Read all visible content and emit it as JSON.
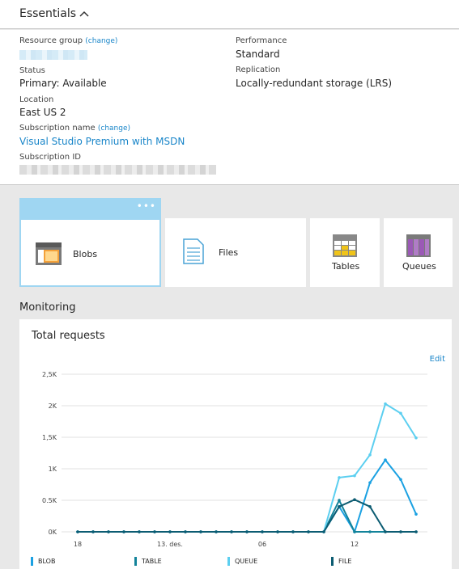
{
  "header": {
    "title": "Essentials"
  },
  "essentials": {
    "resource_group": {
      "label": "Resource group",
      "change": "(change)"
    },
    "status": {
      "label": "Status",
      "value": "Primary: Available"
    },
    "location": {
      "label": "Location",
      "value": "East US 2"
    },
    "subscription_name": {
      "label": "Subscription name",
      "change": "(change)",
      "value": "Visual Studio Premium with MSDN"
    },
    "subscription_id": {
      "label": "Subscription ID"
    },
    "performance": {
      "label": "Performance",
      "value": "Standard"
    },
    "replication": {
      "label": "Replication",
      "value": "Locally-redundant storage (LRS)"
    }
  },
  "services": {
    "blobs": "Blobs",
    "files": "Files",
    "tables": "Tables",
    "queues": "Queues",
    "more": "•••"
  },
  "monitoring": {
    "heading": "Monitoring",
    "edit": "Edit"
  },
  "colors": {
    "blob": "#1ba1e2",
    "table": "#13839a",
    "queue": "#5ccff0",
    "file": "#0c5c72",
    "accent": "#1a86c9"
  },
  "chart_data": {
    "type": "line",
    "title": "Total requests",
    "ylim": [
      0,
      2500
    ],
    "y_ticks": [
      "2,5K",
      "2K",
      "1,5K",
      "1K",
      "0.5K",
      "0K"
    ],
    "y_tick_values": [
      2500,
      2000,
      1500,
      1000,
      500,
      0
    ],
    "x_ticks": [
      "18",
      "13. des.",
      "06",
      "12"
    ],
    "x_tick_index": [
      0,
      6,
      12,
      18
    ],
    "grid": true,
    "legend": "bottom",
    "series": [
      {
        "name": "BLOB",
        "color": "#1ba1e2",
        "values": [
          0,
          0,
          0,
          0,
          0,
          0,
          0,
          0,
          0,
          0,
          0,
          0,
          0,
          0,
          0,
          0,
          0,
          400,
          0,
          780,
          1140,
          830,
          280
        ]
      },
      {
        "name": "TABLE",
        "color": "#13839a",
        "values": [
          0,
          0,
          0,
          0,
          0,
          0,
          0,
          0,
          0,
          0,
          0,
          0,
          0,
          0,
          0,
          0,
          0,
          500,
          0,
          0,
          0,
          0,
          0
        ]
      },
      {
        "name": "QUEUE",
        "color": "#5ccff0",
        "values": [
          0,
          0,
          0,
          0,
          0,
          0,
          0,
          0,
          0,
          0,
          0,
          0,
          0,
          0,
          0,
          0,
          0,
          860,
          890,
          1220,
          2030,
          1880,
          1490
        ]
      },
      {
        "name": "FILE",
        "color": "#0c5c72",
        "values": [
          0,
          0,
          0,
          0,
          0,
          0,
          0,
          0,
          0,
          0,
          0,
          0,
          0,
          0,
          0,
          0,
          0,
          400,
          510,
          400,
          0,
          0,
          0
        ]
      }
    ]
  }
}
